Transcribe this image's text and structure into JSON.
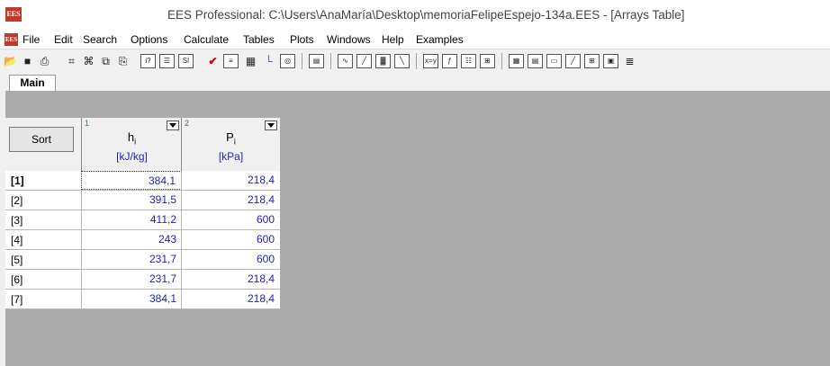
{
  "window": {
    "title": "EES Professional:  C:\\Users\\AnaMaría\\Desktop\\memoriaFelipeEspejo-134a.EES - [Arrays Table]",
    "app_icon_text": "EES"
  },
  "menu": [
    "File",
    "Edit",
    "Search",
    "Options",
    "Calculate",
    "Tables",
    "Plots",
    "Windows",
    "Help",
    "Examples"
  ],
  "toolbar": {
    "icons": [
      "open-icon",
      "save-icon",
      "print-icon",
      "find-icon",
      "find-next-icon",
      "copy-icon",
      "paste-icon",
      "info-icon",
      "calculator-icon",
      "units-icon",
      "check-icon",
      "solve-icon",
      "table-icon",
      "plot-icon",
      "diagram-icon",
      "window-icon",
      "line-plot-icon",
      "xy-plot-icon",
      "bar-plot-icon",
      "overlay-plot-icon",
      "xy-function-icon",
      "function-icon",
      "form-icon",
      "lookup-icon",
      "parametric-icon",
      "arrays-icon",
      "window-list-icon",
      "plot-window-icon",
      "grid-icon",
      "image-icon",
      "align-icon"
    ]
  },
  "tabs": {
    "main": "Main"
  },
  "table": {
    "sort_label": "Sort",
    "columns": [
      {
        "num": "1",
        "name": "h",
        "sub": "i",
        "unit": "[kJ/kg]"
      },
      {
        "num": "2",
        "name": "P",
        "sub": "i",
        "unit": "[kPa]"
      }
    ],
    "rows": [
      {
        "label": "[1]",
        "h": "384,1",
        "P": "218,4"
      },
      {
        "label": "[2]",
        "h": "391,5",
        "P": "218,4"
      },
      {
        "label": "[3]",
        "h": "411,2",
        "P": "600"
      },
      {
        "label": "[4]",
        "h": "243",
        "P": "600"
      },
      {
        "label": "[5]",
        "h": "231,7",
        "P": "600"
      },
      {
        "label": "[6]",
        "h": "231,7",
        "P": "218,4"
      },
      {
        "label": "[7]",
        "h": "384,1",
        "P": "218,4"
      }
    ]
  },
  "colors": {
    "value_text": "#1f1fbf",
    "app_icon_bg": "#c0392b",
    "canvas_bg": "#ababab"
  }
}
